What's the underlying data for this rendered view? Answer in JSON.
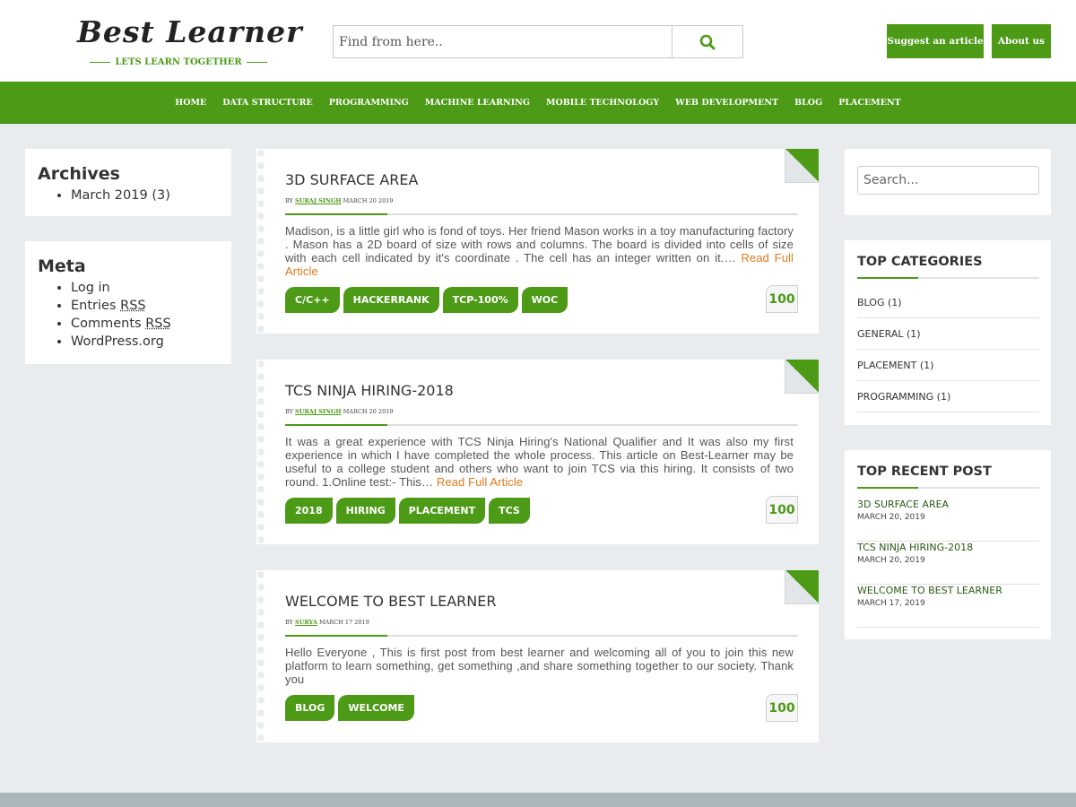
{
  "logo": {
    "text": "Best Learner",
    "tagline": "LETS LEARN TOGETHER"
  },
  "search": {
    "placeholder": "Find from here.."
  },
  "header_buttons": {
    "suggest": "Suggest an article",
    "about": "About us"
  },
  "nav": [
    "HOME",
    "DATA STRUCTURE",
    "PROGRAMMING",
    "MACHINE LEARNING",
    "MOBILE TECHNOLOGY",
    "WEB DEVELOPMENT",
    "BLOG",
    "PLACEMENT"
  ],
  "archives": {
    "title": "Archives",
    "items": [
      "March 2019 (3)"
    ]
  },
  "meta": {
    "title": "Meta",
    "login": "Log in",
    "entries_prefix": "Entries ",
    "comments_prefix": "Comments ",
    "rss": "RSS",
    "wordpress": "WordPress.org"
  },
  "posts": [
    {
      "title": "3D SURFACE AREA",
      "by": "BY",
      "author": "SURAJ SINGH",
      "date": "MARCH 20 2019",
      "excerpt": "Madison, is a little girl who is fond of toys. Her friend Mason works in a toy manufacturing factory . Mason has a 2D board of size with rows and columns. The board is divided into cells of size with each cell indicated by it's coordinate . The cell has an integer written on it.…",
      "more": "Read Full Article",
      "tags": [
        "C/C++",
        "HACKERRANK",
        "TCP-100%",
        "WOC"
      ],
      "score": "100"
    },
    {
      "title": "TCS NINJA HIRING-2018",
      "by": "BY",
      "author": "SURAJ SINGH",
      "date": "MARCH 20 2019",
      "excerpt": "It was a great experience with TCS Ninja Hiring's National Qualifier and It was also my first experience in which I have completed the whole process. This article on Best-Learner may be useful to a college student and others who want to join TCS via this hiring. It consists of two round. 1.Online test:- This…",
      "more": "Read Full Article",
      "tags": [
        "2018",
        "HIRING",
        "PLACEMENT",
        "TCS"
      ],
      "score": "100"
    },
    {
      "title": "WELCOME TO BEST LEARNER",
      "by": "BY",
      "author": "SURYA",
      "date": "MARCH 17 2019",
      "excerpt": "Hello Everyone , This is first post from best learner and welcoming all of you to join this new platform to learn something, get something ,and share something together to our society. Thank you",
      "more": "",
      "tags": [
        "BLOG",
        "WELCOME"
      ],
      "score": "100"
    }
  ],
  "sidebar_search": {
    "placeholder": "Search..."
  },
  "top_categories": {
    "title": "TOP CATEGORIES",
    "items": [
      "BLOG (1)",
      "GENERAL (1)",
      "PLACEMENT (1)",
      "PROGRAMMING (1)"
    ]
  },
  "top_recent": {
    "title": "TOP RECENT POST",
    "items": [
      {
        "title": "3D SURFACE AREA",
        "date": "MARCH 20, 2019"
      },
      {
        "title": "TCS NINJA HIRING-2018",
        "date": "MARCH 20, 2019"
      },
      {
        "title": "WELCOME TO BEST LEARNER",
        "date": "MARCH 17, 2019"
      }
    ]
  },
  "colors": {
    "accent": "#4c9a16",
    "read_more": "#e07a1c",
    "background": "#e9ecee"
  }
}
